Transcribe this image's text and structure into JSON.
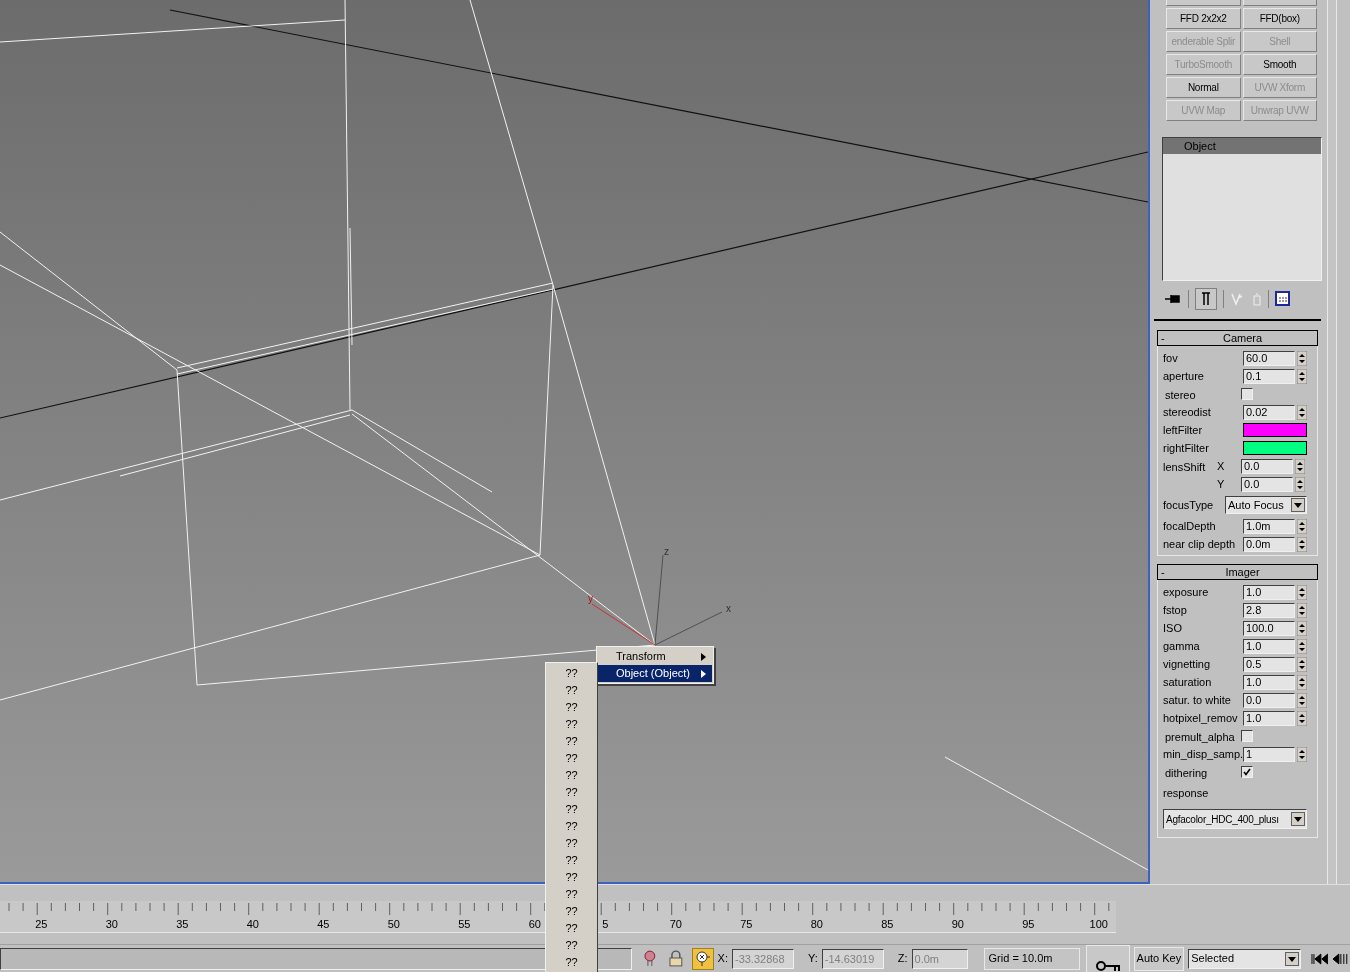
{
  "viewport": {
    "gizmo_axes": [
      {
        "axis": "z"
      },
      {
        "axis": "x"
      },
      {
        "axis": "y"
      }
    ]
  },
  "context_menu": {
    "items": [
      {
        "label": "Transform",
        "selected": false
      },
      {
        "label": "Object (Object)",
        "selected": true
      }
    ]
  },
  "submenu": {
    "items": [
      "??",
      "??",
      "??",
      "??",
      "??",
      "??",
      "??",
      "??",
      "??",
      "??",
      "??",
      "??",
      "??",
      "??",
      "??",
      "??",
      "??",
      "??"
    ]
  },
  "modifier_buttons": [
    {
      "label": "FFD 2x2x2",
      "disabled": false
    },
    {
      "label": "FFD(box)",
      "disabled": false
    },
    {
      "label": "enderable Splir",
      "disabled": true
    },
    {
      "label": "Shell",
      "disabled": true
    },
    {
      "label": "TurboSmooth",
      "disabled": true
    },
    {
      "label": "Smooth",
      "disabled": false
    },
    {
      "label": "Normal",
      "disabled": false
    },
    {
      "label": "UVW Xform",
      "disabled": true
    },
    {
      "label": "UVW Map",
      "disabled": true
    },
    {
      "label": "Unwrap UVW",
      "disabled": true
    }
  ],
  "modifier_stack": {
    "items": [
      {
        "label": "Object",
        "selected": true
      }
    ]
  },
  "rollouts": [
    {
      "toggle": "-",
      "title": "Camera",
      "params": [
        {
          "kind": "spinner",
          "label": "fov",
          "value": "60.0"
        },
        {
          "kind": "spinner",
          "label": "aperture",
          "value": "0.1"
        },
        {
          "kind": "checkbox",
          "label": "stereo",
          "checked": false
        },
        {
          "kind": "spinner",
          "label": "stereodist",
          "value": "0.02"
        },
        {
          "kind": "color",
          "label": "leftFilter",
          "color": "#ff00ff"
        },
        {
          "kind": "color",
          "label": "rightFilter",
          "color": "#00ff80"
        },
        {
          "kind": "axis",
          "label": "lensShift",
          "axis": "X",
          "value": "0.0"
        },
        {
          "kind": "axis",
          "axis": "Y",
          "value": "0.0"
        },
        {
          "kind": "dropdown",
          "label": "focusType",
          "value": "Auto Focus"
        },
        {
          "kind": "spinner",
          "label": "focalDepth",
          "value": "1.0m"
        },
        {
          "kind": "spinner",
          "label": "near clip depth",
          "value": "0.0m"
        }
      ]
    },
    {
      "toggle": "-",
      "title": "Imager",
      "params": [
        {
          "kind": "spinner",
          "label": "exposure",
          "value": "1.0"
        },
        {
          "kind": "spinner",
          "label": "fstop",
          "value": "2.8"
        },
        {
          "kind": "spinner",
          "label": "ISO",
          "value": "100.0"
        },
        {
          "kind": "spinner",
          "label": "gamma",
          "value": "1.0"
        },
        {
          "kind": "spinner",
          "label": "vignetting",
          "value": "0.5"
        },
        {
          "kind": "spinner",
          "label": "saturation",
          "value": "1.0"
        },
        {
          "kind": "spinner",
          "label": "satur. to white",
          "value": "0.0"
        },
        {
          "kind": "spinner",
          "label": "hotpixel_remov",
          "value": "1.0"
        },
        {
          "kind": "checkbox",
          "label": "premult_alpha",
          "checked": false
        },
        {
          "kind": "spinner",
          "label": "min_disp_samp.",
          "value": "1"
        },
        {
          "kind": "checkbox",
          "label": "dithering",
          "checked": true
        },
        {
          "kind": "heading",
          "label": "response"
        },
        {
          "kind": "wide_dropdown",
          "value": "Agfacolor_HDC_400_plusı"
        }
      ]
    }
  ],
  "timeline": {
    "labels": [
      "25",
      "30",
      "35",
      "40",
      "45",
      "50",
      "55",
      "60",
      "5",
      "70",
      "75",
      "80",
      "85",
      "90",
      "95",
      "100"
    ]
  },
  "status_bar": {
    "x_label": "X:",
    "x_value": "-33.32868",
    "y_label": "Y:",
    "y_value": "-14.63019",
    "z_label": "Z:",
    "z_value": "0.0m",
    "grid": "Grid = 10.0m",
    "auto_key": "Auto Key",
    "key_filter": "Selected"
  }
}
